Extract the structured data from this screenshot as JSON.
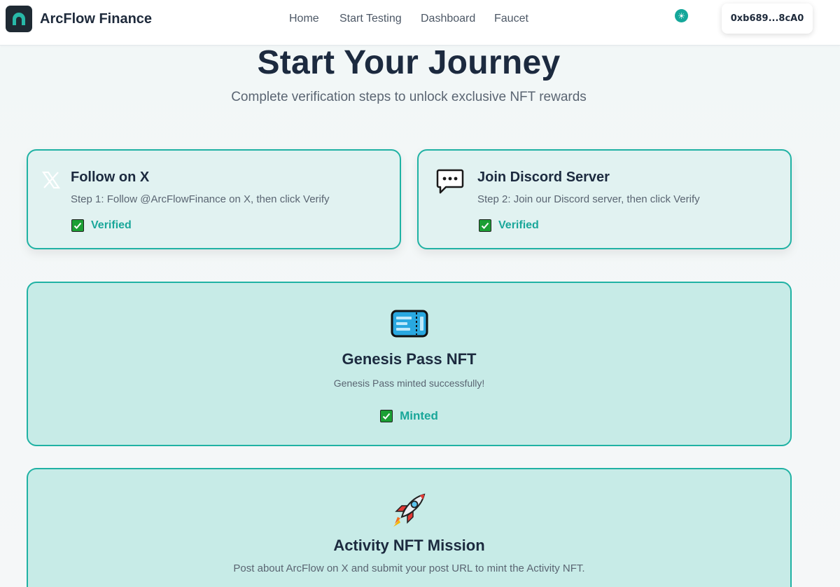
{
  "header": {
    "brand": "ArcFlow Finance",
    "nav": [
      "Home",
      "Start Testing",
      "Dashboard",
      "Faucet"
    ],
    "theme_icon": "sun-icon",
    "wallet": "0xb689...8cA0"
  },
  "hero": {
    "title": "Start Your Journey",
    "subtitle": "Complete verification steps to unlock exclusive NFT rewards"
  },
  "steps": [
    {
      "icon": "x-logo-icon",
      "title": "Follow on X",
      "description": "Step 1: Follow @ArcFlowFinance on X, then click Verify",
      "status": "Verified"
    },
    {
      "icon": "speech-bubble-icon",
      "title": "Join Discord Server",
      "description": "Step 2: Join our Discord server, then click Verify",
      "status": "Verified"
    }
  ],
  "genesis": {
    "icon": "ticket-icon",
    "title": "Genesis Pass NFT",
    "description": "Genesis Pass minted successfully!",
    "status": "Minted"
  },
  "activity": {
    "icon": "rocket-icon",
    "title": "Activity NFT Mission",
    "description": "Post about ArcFlow on X and submit your post URL to mint the Activity NFT."
  },
  "colors": {
    "accent": "#20b2a4",
    "success": "#1aa79a",
    "dark": "#1c2a3f"
  }
}
